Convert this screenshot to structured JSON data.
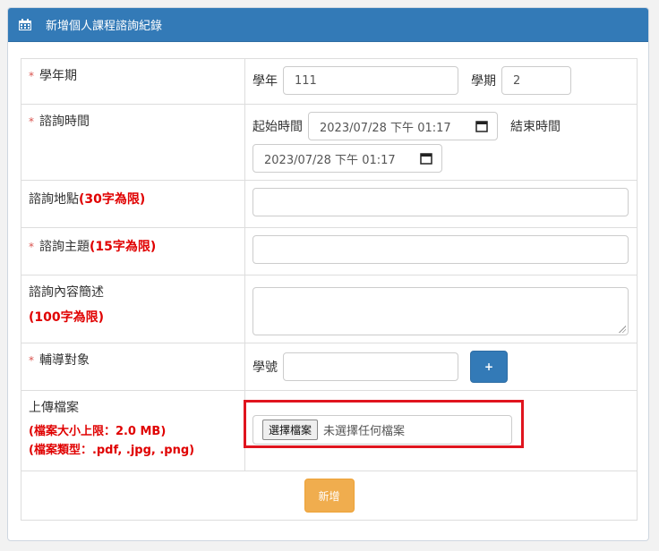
{
  "header": {
    "title": "新增個人課程諮詢紀錄",
    "icon": "calendar-icon"
  },
  "form": {
    "semester": {
      "label": "學年期",
      "year_label": "學年",
      "year_value": "111",
      "term_label": "學期",
      "term_value": "2"
    },
    "time": {
      "label": "諮詢時間",
      "start_label": "起始時間",
      "start_value": "2023/07/28 下午 01:17",
      "end_label": "結束時間",
      "end_value": "2023/07/28 下午 01:17"
    },
    "location": {
      "label": "諮詢地點",
      "limit": "(30字為限)",
      "value": ""
    },
    "topic": {
      "label": "諮詢主題",
      "limit": "(15字為限)",
      "value": ""
    },
    "summary": {
      "label": "諮詢內容簡述",
      "limit": "(100字為限)",
      "value": ""
    },
    "target": {
      "label": "輔導對象",
      "id_label": "學號",
      "id_value": "",
      "add_label": "+"
    },
    "upload": {
      "label": "上傳檔案",
      "size_limit": "(檔案大小上限：2.0 MB)",
      "type_limit": "(檔案類型：.pdf, .jpg, .png)",
      "button_label": "選擇檔案",
      "status": "未選擇任何檔案"
    },
    "required_mark": "*",
    "submit_label": "新增"
  },
  "colors": {
    "header": "#337ab7",
    "required": "#d9534f",
    "limit_text": "#e00000",
    "submit": "#f0ad4e",
    "highlight": "#e0141e"
  }
}
